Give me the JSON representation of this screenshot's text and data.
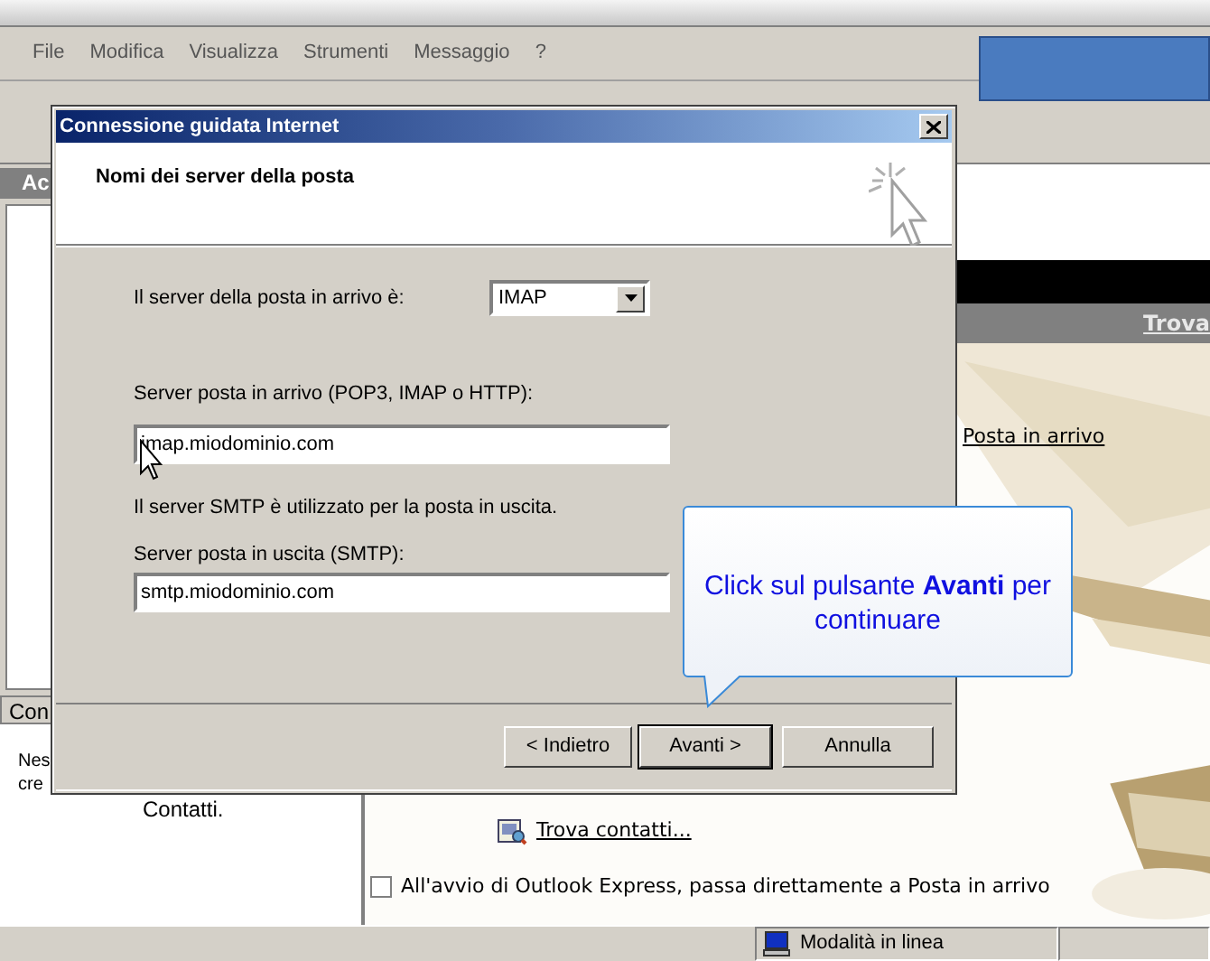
{
  "menu": [
    {
      "label": "File"
    },
    {
      "label": "Modifica"
    },
    {
      "label": "Visualizza"
    },
    {
      "label": "Strumenti"
    },
    {
      "label": "Messaggio"
    },
    {
      "label": "?"
    }
  ],
  "left_pane": {
    "header": "Ac",
    "contacts_tab": "Con",
    "contacts_lines": [
      "Nes",
      "cre"
    ],
    "contacts_end": "Contatti."
  },
  "right_pane": {
    "header_link": "Trova",
    "inbox_link": "Posta in arrivo",
    "find_contacts_link": "Trova contatti...",
    "startup_checkbox": {
      "label": "All'avvio di Outlook Express, passa direttamente a Posta in arrivo",
      "checked": false
    }
  },
  "status_bar": {
    "connection": "Modalità in linea"
  },
  "dialog": {
    "title": "Connessione guidata Internet",
    "heading": "Nomi dei server della posta",
    "server_type_label": "Il server della posta in arrivo è:",
    "server_type": "IMAP",
    "incoming_label": "Server posta in arrivo (POP3, IMAP o HTTP):",
    "incoming_value": "imap.miodominio.com",
    "smtp_note": "Il server SMTP è utilizzato per la posta in uscita.",
    "outgoing_label": "Server posta in uscita (SMTP):",
    "outgoing_value": "smtp.miodominio.com",
    "buttons": [
      {
        "label": "< Indietro",
        "default": false
      },
      {
        "label": "Avanti >",
        "default": true
      },
      {
        "label": "Annulla",
        "default": false
      }
    ]
  },
  "callout": {
    "text": "Click sul pulsante **Avanti** per continuare"
  }
}
